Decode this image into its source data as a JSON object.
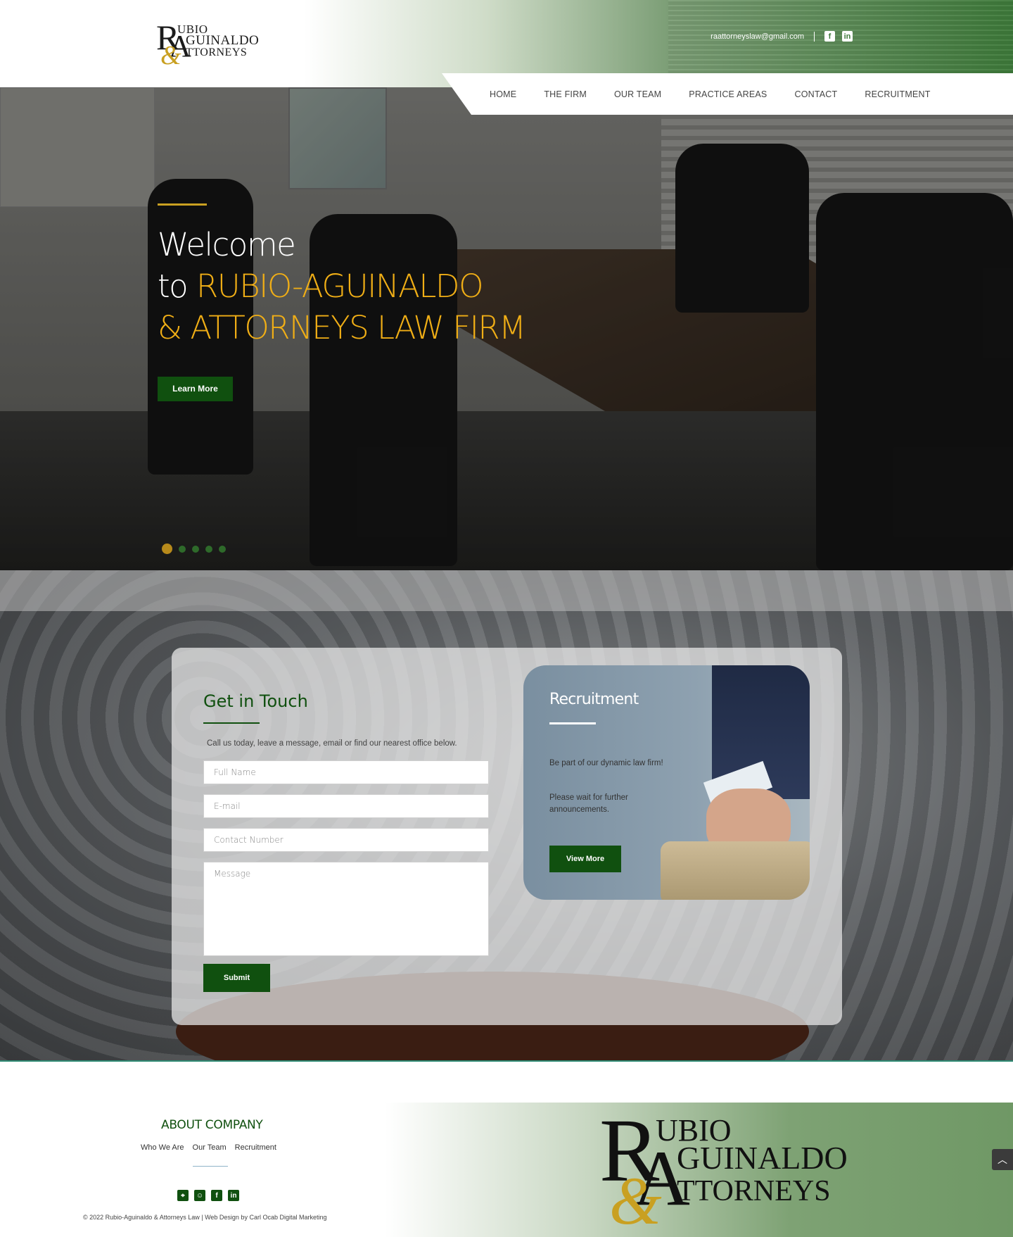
{
  "header": {
    "logo": {
      "line1": "UBIO",
      "line2": "GUINALDO",
      "line3": "TTORNEYS",
      "r": "R",
      "a": "A",
      "amp": "&"
    },
    "email": "raattorneyslaw@gmail.com",
    "social": [
      {
        "icon": "facebook-icon",
        "glyph": "f"
      },
      {
        "icon": "linkedin-icon",
        "glyph": "in"
      }
    ],
    "nav": [
      "HOME",
      "THE FIRM",
      "OUR TEAM",
      "PRACTICE AREAS",
      "CONTACT",
      "RECRUITMENT"
    ]
  },
  "hero": {
    "title_line1": "Welcome",
    "title_to": "to ",
    "title_gold1": "RUBIO-AGUINALDO",
    "title_gold2": "& ATTORNEYS LAW FIRM",
    "button": "Learn More",
    "slides": 5,
    "active_slide": 1
  },
  "contact": {
    "title": "Get in Touch",
    "description": "Call us today, leave a message, email or find our nearest office below.",
    "placeholders": {
      "name": "Full Name",
      "email": "E-mail",
      "phone": "Contact Number",
      "message": "Message"
    },
    "submit": "Submit"
  },
  "recruitment": {
    "title": "Recruitment",
    "text1": "Be part of our dynamic law firm!",
    "text2": "Please wait for further announcements.",
    "button": "View More"
  },
  "footer": {
    "about_title": "ABOUT COMPANY",
    "links": [
      "Who We Are",
      "Our Team",
      "Recruitment"
    ],
    "icons": [
      {
        "icon": "location-pin-icon",
        "glyph": "⌖"
      },
      {
        "icon": "chat-icon",
        "glyph": "☺"
      },
      {
        "icon": "facebook-icon",
        "glyph": "f"
      },
      {
        "icon": "linkedin-icon",
        "glyph": "in"
      }
    ],
    "copyright": "© 2022 Rubio-Aguinaldo & Attorneys Law | Web Design by Carl Ocab Digital Marketing",
    "logo": {
      "line1": "UBIO",
      "line2": "GUINALDO",
      "line3": "TTORNEYS",
      "r": "R",
      "a": "A",
      "amp": "&"
    }
  },
  "scroll_top": "︿",
  "colors": {
    "brand_green": "#10500f",
    "gold": "#f0ae16",
    "teal": "#2e8a73"
  }
}
